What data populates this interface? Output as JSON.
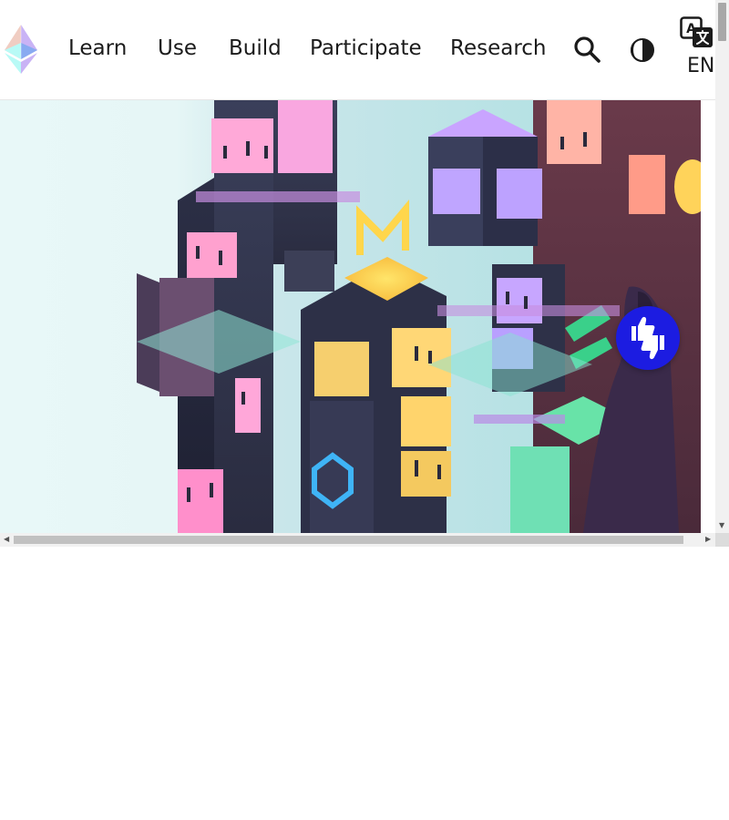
{
  "nav": {
    "logo": "ethereum-logo",
    "items": [
      {
        "label": "Learn"
      },
      {
        "label": "Use"
      },
      {
        "label": "Build"
      },
      {
        "label": "Participate"
      },
      {
        "label": "Research"
      }
    ],
    "icons": {
      "search": "search-icon",
      "theme": "theme-toggle-icon",
      "language": "translate-icon"
    },
    "language_code": "EN"
  },
  "hero": {
    "image": "isometric-city-illustration"
  },
  "feedback": {
    "icon": "thumbs-up-down-icon"
  },
  "colors": {
    "feedback": "#1c1ce1",
    "hero_background": "#e9f8f8"
  }
}
